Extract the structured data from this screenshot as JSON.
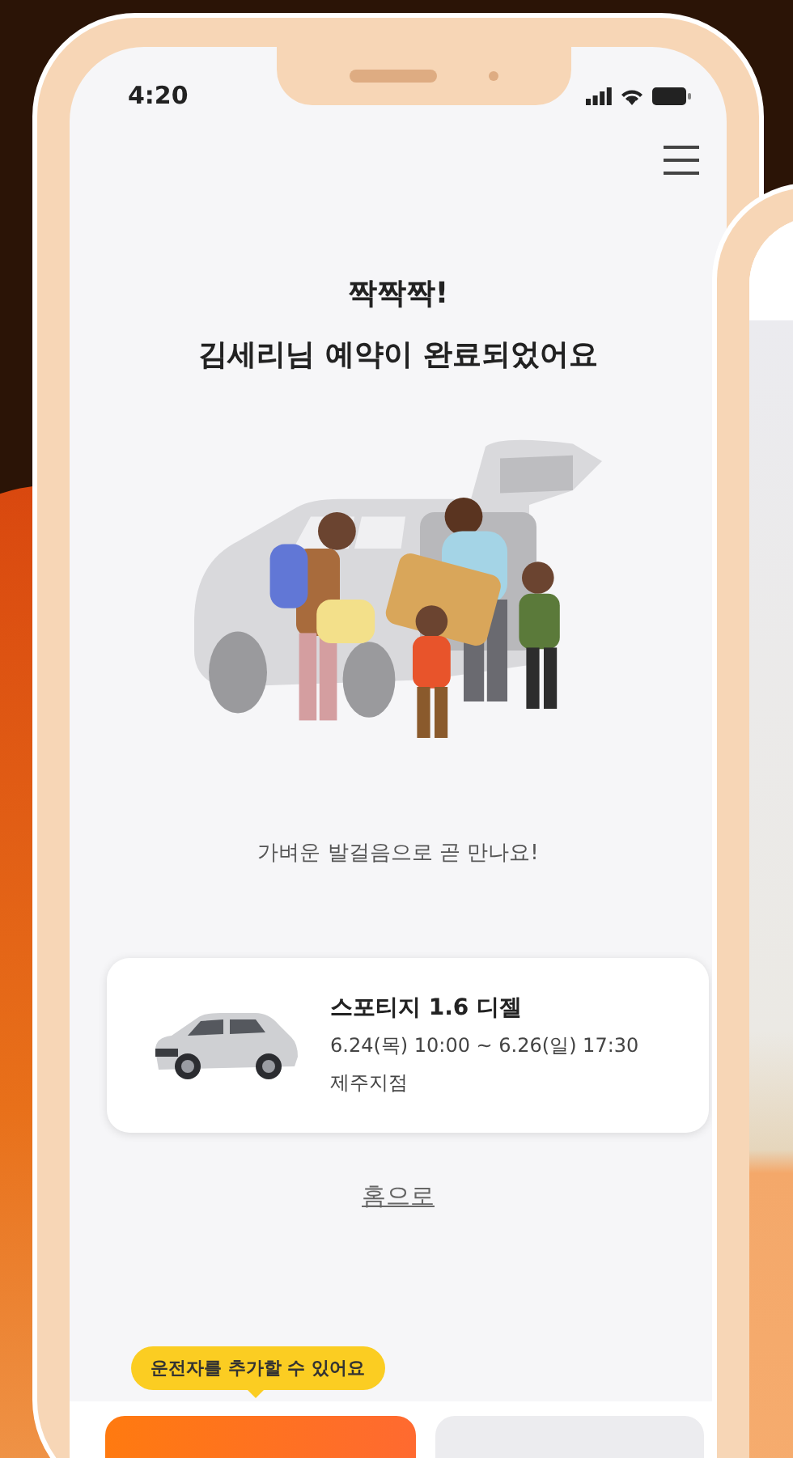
{
  "status_bar": {
    "time": "4:20"
  },
  "header": {
    "title_lines": [
      "짝짝짝!",
      "김세리님 예약이 완료되었어요"
    ]
  },
  "caption": "가벼운 발걸음으로 곧 만나요!",
  "reservation": {
    "car_name": "스포티지 1.6 디젤",
    "period": "6.24(목) 10:00 ~ 6.26(일) 17:30",
    "branch": "제주지점"
  },
  "home_link": "홈으로",
  "tooltip": "운전자를 추가할 수 있어요"
}
